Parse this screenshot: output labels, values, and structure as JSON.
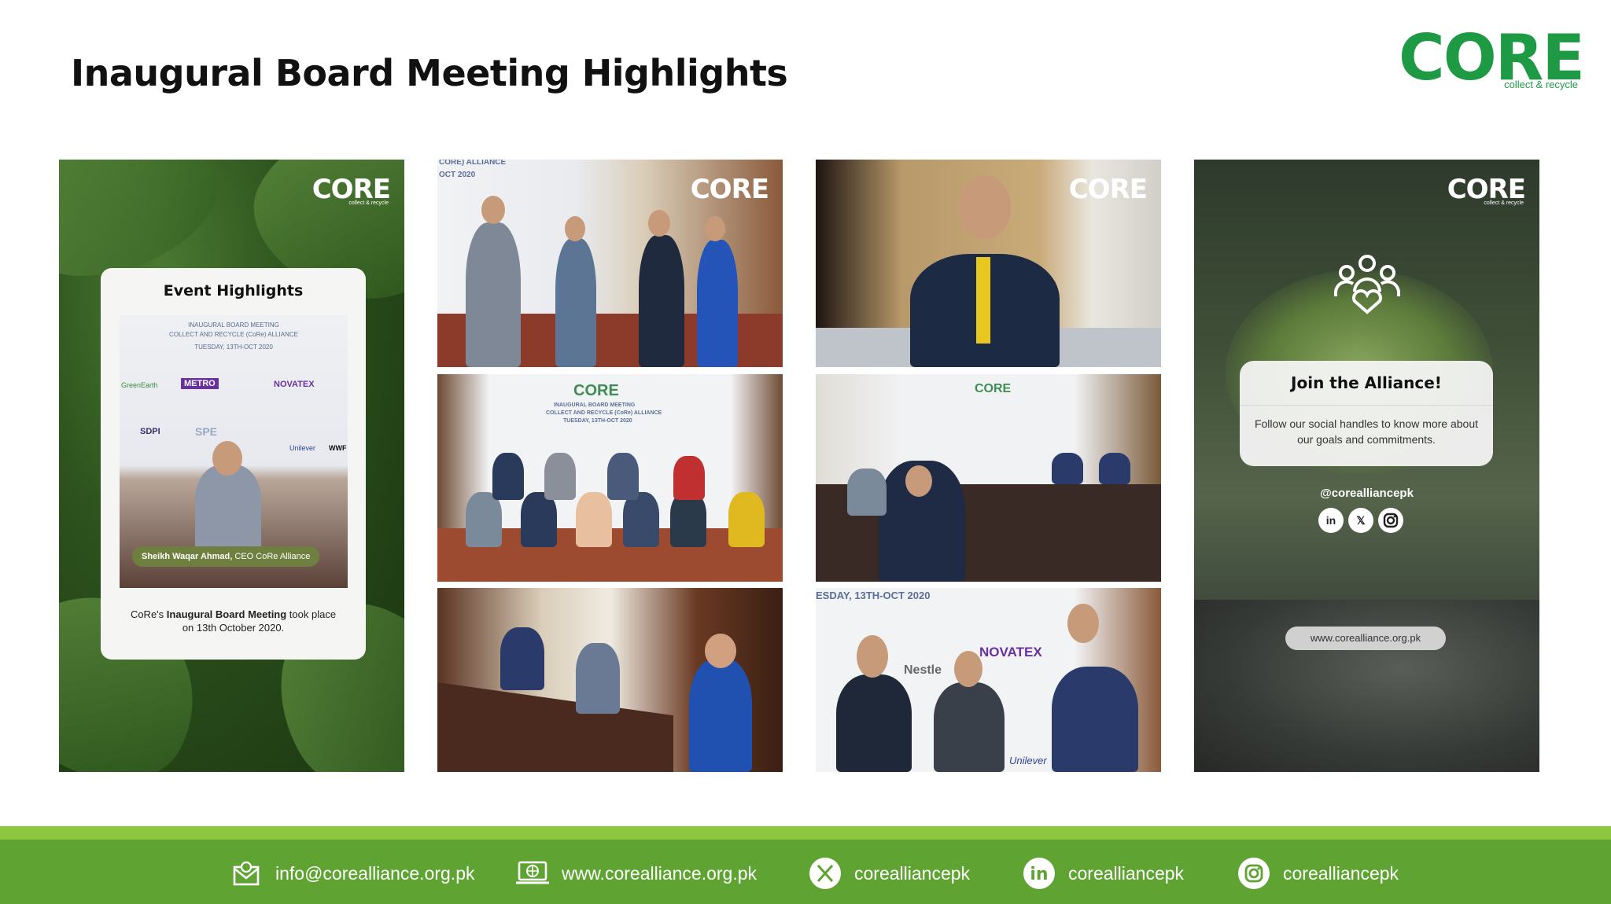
{
  "header": {
    "title": "Inaugural Board Meeting Highlights",
    "logo_word": "CORE",
    "logo_tagline": "collect & recycle"
  },
  "colors": {
    "brand_green": "#1e9a45",
    "footer_green": "#5fa432",
    "footer_top_green": "#8dc63f",
    "badge_olive": "#6e7f3f"
  },
  "panels": {
    "mini_logo": "CORE",
    "mini_logo_tag": "collect & recycle",
    "event_card": {
      "title": "Event Highlights",
      "photo_lines": [
        "INAUGURAL BOARD MEETING",
        "COLLECT AND RECYCLE (CoRe) ALLIANCE",
        "TUESDAY, 13TH-OCT 2020"
      ],
      "photo_sponsors": [
        "GreenEarth",
        "METRO",
        "NOVATEX",
        "SDPI",
        "SPE",
        "Unilever",
        "WWF"
      ],
      "badge_name": "Sheikh Waqar Ahmad,",
      "badge_role": " CEO CoRe Alliance",
      "caption_pre": "CoRe's ",
      "caption_bold": "Inaugural Board Meeting",
      "caption_post": " took place on 13th October 2020."
    },
    "photo_banner_text": "CORE",
    "photo_banner_lines": [
      "INAUGURAL BOARD MEETING",
      "COLLECT AND RECYCLE (CoRe) ALLIANCE",
      "TUESDAY, 13TH-OCT 2020"
    ],
    "photo_top_left_text": [
      "CORE) ALLIANCE",
      "OCT 2020"
    ],
    "photo_bottom_banner_text": "ESDAY, 13TH-OCT 2020",
    "photo_brand_texts": [
      "Nestle",
      "NOVATEX",
      "Unilever"
    ],
    "join_card": {
      "title": "Join the Alliance!",
      "text": "Follow our social handles to know more about our goals and commitments.",
      "handle": "@corealliancepk",
      "social_icons": [
        "linkedin-icon",
        "x-icon",
        "instagram-icon"
      ],
      "site": "www.corealliance.org.pk"
    }
  },
  "footer": {
    "email": "info@corealliance.org.pk",
    "website": "www.corealliance.org.pk",
    "x_handle": "corealliancepk",
    "linkedin_handle": "corealliancepk",
    "instagram_handle": "corealliancepk"
  }
}
